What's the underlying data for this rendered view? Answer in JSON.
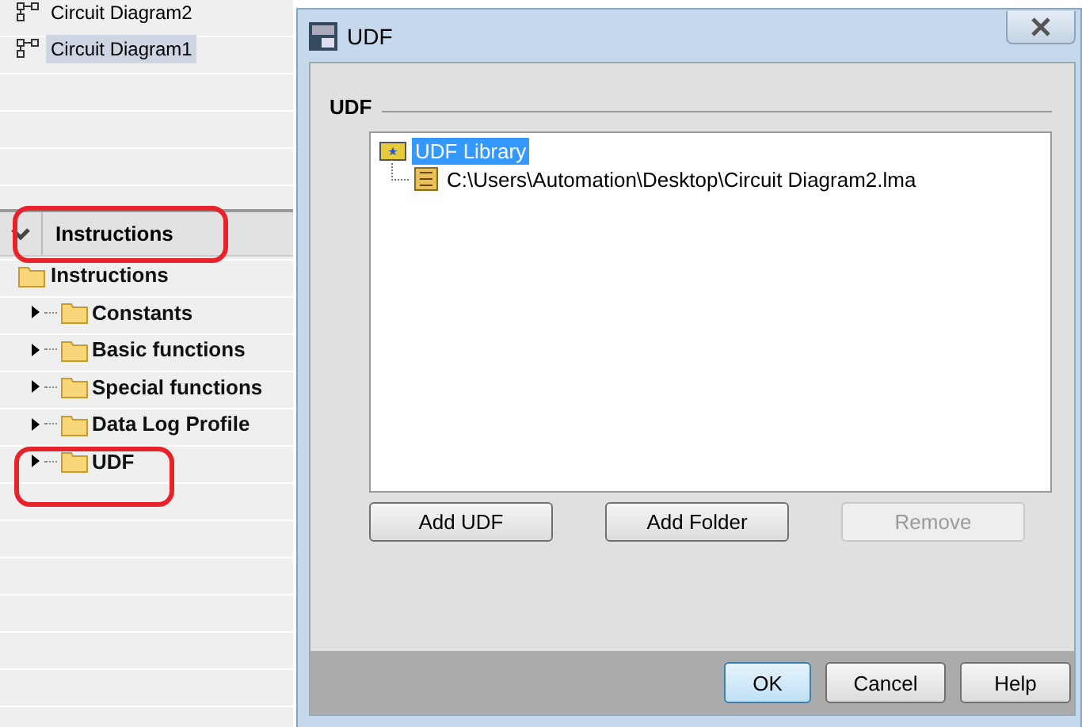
{
  "projects": [
    {
      "label": "Circuit Diagram2",
      "selected": false
    },
    {
      "label": "Circuit Diagram1",
      "selected": true
    }
  ],
  "instructions_panel": {
    "title": "Instructions",
    "expanded": true
  },
  "instruction_tree": {
    "label": "Instructions",
    "children": [
      {
        "label": "Constants",
        "expanded": false
      },
      {
        "label": "Basic functions",
        "expanded": false
      },
      {
        "label": "Special functions",
        "expanded": false
      },
      {
        "label": "Data Log Profile",
        "expanded": false
      },
      {
        "label": "UDF",
        "expanded": false
      }
    ]
  },
  "dialog": {
    "title": "UDF",
    "group_title": "UDF",
    "tree": [
      {
        "label": "UDF Library",
        "selected": true,
        "children": [
          {
            "label": "C:\\Users\\Automation\\Desktop\\Circuit Diagram2.lma",
            "selected": false
          }
        ]
      }
    ],
    "buttons": [
      {
        "label": "Add UDF",
        "disabled": false
      },
      {
        "label": "Add Folder",
        "disabled": false
      },
      {
        "label": "Remove",
        "disabled": true
      }
    ],
    "footer_buttons": [
      {
        "label": "OK",
        "default": true
      },
      {
        "label": "Cancel",
        "default": false
      },
      {
        "label": "Help",
        "default": false
      }
    ]
  }
}
